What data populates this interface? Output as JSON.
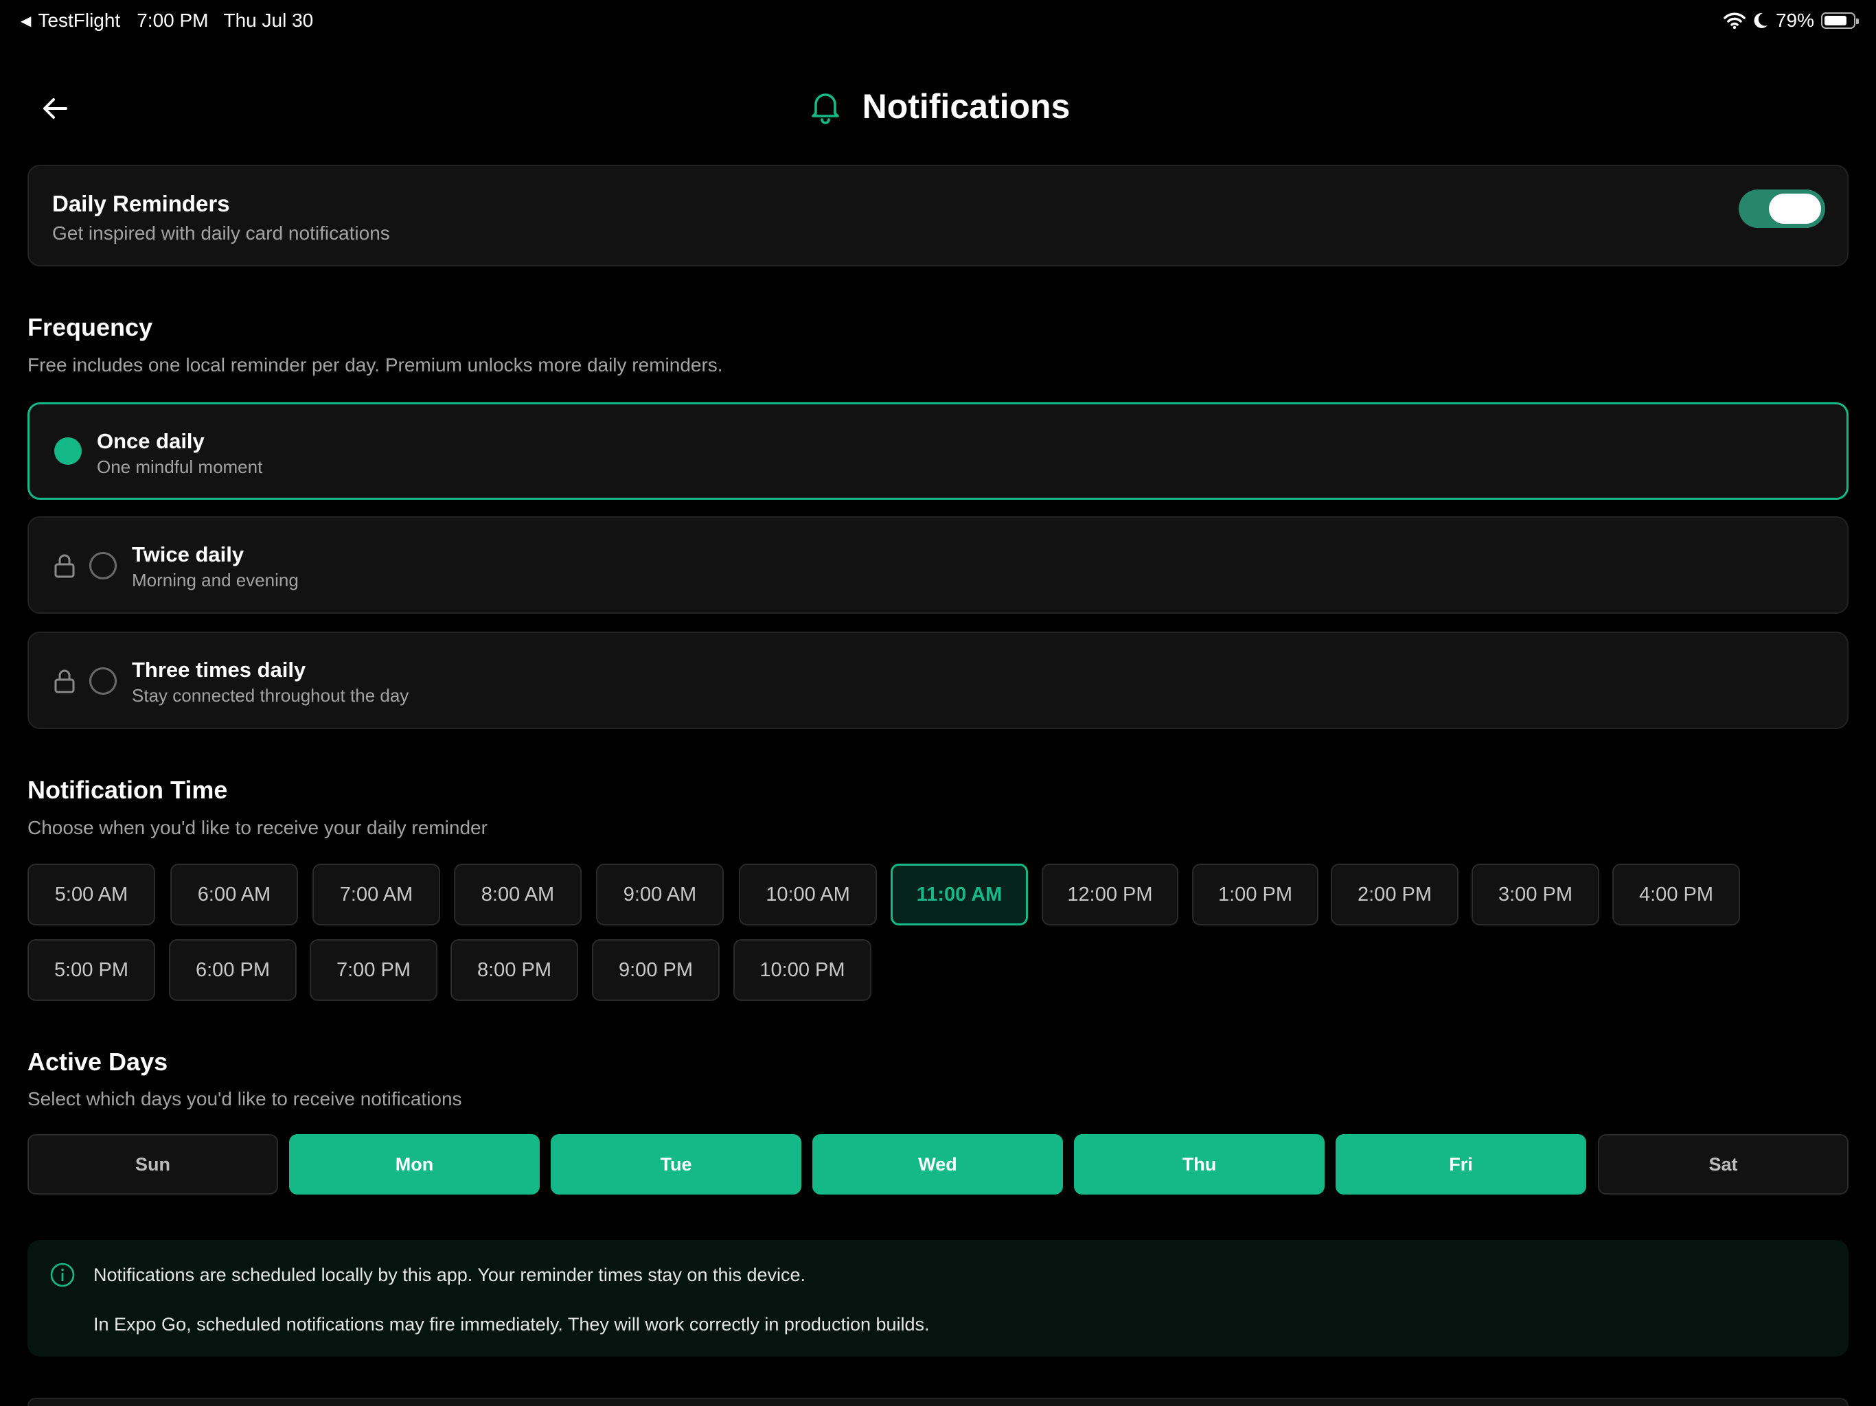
{
  "status_bar": {
    "back_app": "TestFlight",
    "time": "7:00 PM",
    "date": "Thu Jul 30",
    "battery": "79%",
    "battery_level": 0.79
  },
  "header": {
    "title": "Notifications"
  },
  "daily_reminders": {
    "title": "Daily Reminders",
    "subtitle": "Get inspired with daily card notifications",
    "enabled": true
  },
  "frequency": {
    "title": "Frequency",
    "subtitle": "Free includes one local reminder per day. Premium unlocks more daily reminders.",
    "options": [
      {
        "label": "Once daily",
        "sub": "One mindful moment",
        "selected": true,
        "locked": false
      },
      {
        "label": "Twice daily",
        "sub": "Morning and evening",
        "selected": false,
        "locked": true
      },
      {
        "label": "Three times daily",
        "sub": "Stay connected throughout the day",
        "selected": false,
        "locked": true
      }
    ]
  },
  "notification_time": {
    "title": "Notification Time",
    "subtitle": "Choose when you'd like to receive your daily reminder",
    "times": [
      "5:00 AM",
      "6:00 AM",
      "7:00 AM",
      "8:00 AM",
      "9:00 AM",
      "10:00 AM",
      "11:00 AM",
      "12:00 PM",
      "1:00 PM",
      "2:00 PM",
      "3:00 PM",
      "4:00 PM",
      "5:00 PM",
      "6:00 PM",
      "7:00 PM",
      "8:00 PM",
      "9:00 PM",
      "10:00 PM"
    ],
    "selected": "11:00 AM"
  },
  "active_days": {
    "title": "Active Days",
    "subtitle": "Select which days you'd like to receive notifications",
    "days": [
      {
        "label": "Sun",
        "active": false
      },
      {
        "label": "Mon",
        "active": true
      },
      {
        "label": "Tue",
        "active": true
      },
      {
        "label": "Wed",
        "active": true
      },
      {
        "label": "Thu",
        "active": true
      },
      {
        "label": "Fri",
        "active": true
      },
      {
        "label": "Sat",
        "active": false
      }
    ]
  },
  "info": {
    "line1": "Notifications are scheduled locally by this app. Your reminder times stay on this device.",
    "line2": "In Expo Go, scheduled notifications may fire immediately. They will work correctly in production builds."
  },
  "colors": {
    "accent": "#14b987",
    "background": "#000000",
    "card": "#121212"
  }
}
